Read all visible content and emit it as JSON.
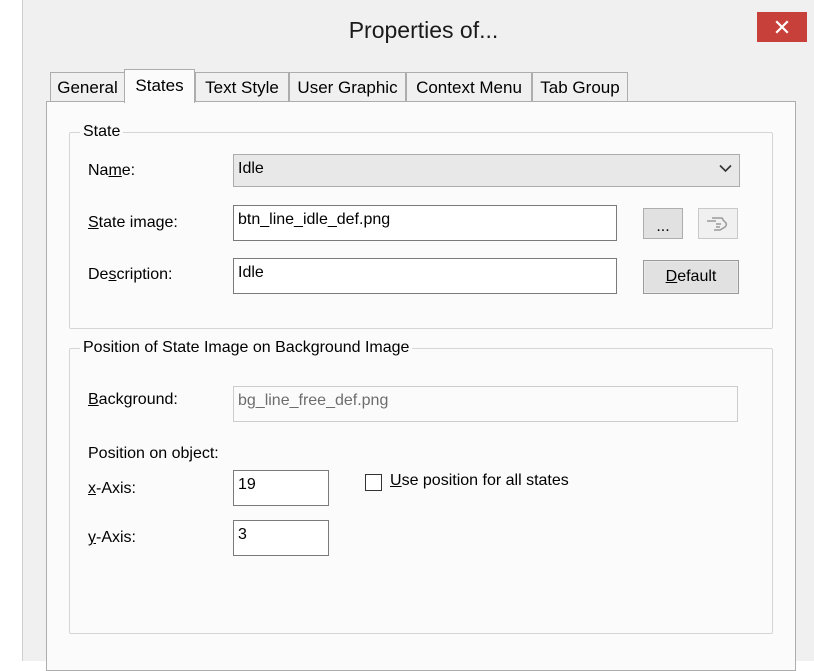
{
  "window": {
    "title": "Properties of...",
    "close_icon": "close-icon",
    "close_color": "#c7403a"
  },
  "tabs": [
    {
      "label": "General",
      "active": false
    },
    {
      "label": "States",
      "active": true
    },
    {
      "label": "Text Style",
      "active": false
    },
    {
      "label": "User Graphic",
      "active": false
    },
    {
      "label": "Context Menu",
      "active": false
    },
    {
      "label": "Tab Group",
      "active": false
    }
  ],
  "state_group": {
    "legend": "State",
    "name": {
      "pre": "Na",
      "key": "m",
      "post": "e:",
      "value": "Idle",
      "icon": "chevron-down-icon"
    },
    "state_image": {
      "pre": "",
      "key": "S",
      "post": "tate image:",
      "value": "btn_line_idle_def.png"
    },
    "description": {
      "pre": "De",
      "key": "s",
      "post": "cription:",
      "value": "Idle"
    },
    "browse_label": "...",
    "pick_icon": "hand-pointer-icon",
    "default_button": {
      "pre": "",
      "key": "D",
      "post": "efault"
    }
  },
  "position_group": {
    "legend": "Position of State Image on Background Image",
    "background": {
      "pre": "",
      "key": "B",
      "post": "ackground:",
      "value": "bg_line_free_def.png"
    },
    "position_label": "Position on object:",
    "x_axis": {
      "pre": "",
      "key": "x",
      "post": "-Axis:",
      "value": "19"
    },
    "y_axis": {
      "pre": "",
      "key": "y",
      "post": "-Axis:",
      "value": "3"
    },
    "use_all": {
      "pre": "",
      "key": "U",
      "post": "se position for all states",
      "checked": false
    }
  }
}
